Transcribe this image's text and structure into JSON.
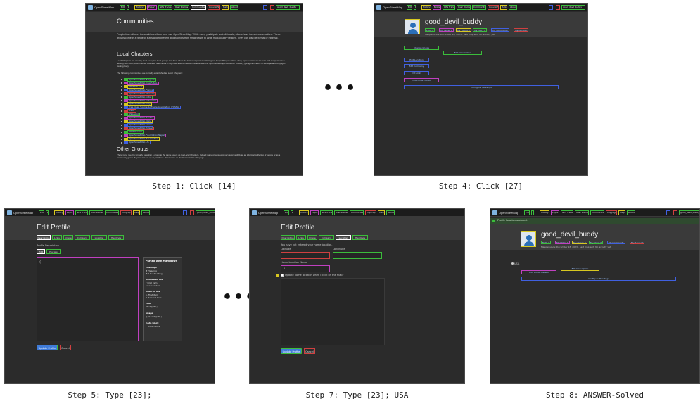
{
  "steps": [
    {
      "caption": "Step 1: Click [14]"
    },
    {
      "caption": "Step 4: Click [27]"
    },
    {
      "caption": "Step 5: Type [23];"
    },
    {
      "caption": "Step 7: Type [23]; USA"
    },
    {
      "caption": "Step 8: ANSWER-Solved"
    }
  ],
  "ellipsis": "•••",
  "osm": {
    "brand": "OpenStreetMap",
    "nav_items": [
      "Edit",
      "▾",
      "History",
      "Export",
      "GPS Traces",
      "User Diaries",
      "Communities",
      "Copyright",
      "Help",
      "About"
    ],
    "user": "good_devil_buddy"
  },
  "communities": {
    "title": "Communities",
    "intro": "People from all over the world contribute to or use OpenStreetMap. While many participate as individuals, others have formed communities. These groups come in a range of sizes and represent geographies from small towns to large multi-country regions. They can also be formal or informal.",
    "local_title": "Local Chapters",
    "local_text": "Local Chapters are country-level or region-level groups that have taken the formal step of establishing not-for-profit legal entities. They represent the area's map and mappers when dealing with local governments, business, and media. They have also formed an affiliation with the OpenStreetMap Foundation (OSMF), giving them a link to the legal and copyright-owning body.",
    "list_intro": "The following communities are formally established as Local Chapters:",
    "chapters": [
      "OpenStreetMap Belgium",
      "OpenStreetMap Czech Rep.",
      "FOSSGIS e.V.",
      "OpenStreetMap France",
      "OpenStreetMap Hungary",
      "OpenStreetMap India",
      "OpenStreetMap Indonesia",
      "OpenStreetMap Italy",
      "Free Open Source Software Association (FOSSA)",
      "OSMF",
      "OSGeo.nl",
      "OpenStreetMap Austria",
      "OpenStreetMap Chile",
      "OpenStreetMap Japan",
      "OpenStreetMap Poland",
      "OSM Ukraine",
      "OpenStreetMap Foundation Nepal",
      "OpenStreetMap Association",
      "OpenStreetMap US"
    ],
    "other_title": "Other Groups",
    "other_text": "There is no need to formally establish a group to the same extent as the Local Chapters. Indeed many groups exist very successfully as an informal gathering of people or as a community group. Anyone can set up or join these. Read more on the Communities wiki page."
  },
  "profile": {
    "username": "good_devil_buddy",
    "stats": [
      "Edits 0",
      "My Notes 0",
      "My Traces 0",
      "My Diary 0",
      "My Comments",
      "My Account"
    ],
    "meta": "Mapper since: December 18, 2023 · Last map edit: No activity yet",
    "links": [
      "Change Image",
      "Edit Description",
      "Edit Location",
      "Edit Company",
      "Edit Links",
      "Edit Profile Details",
      "Configure Headings"
    ]
  },
  "edit_profile": {
    "title": "Edit Profile",
    "tabs": [
      "Description",
      "Links",
      "Image",
      "Company",
      "Location",
      "Headings"
    ],
    "desc_label": "Profile Description",
    "edit_tab": "Edit",
    "preview_tab": "Preview",
    "editor_text": "⟨",
    "parsed_title": "Parsed with Markdown",
    "help": [
      {
        "h": "Headings",
        "t": "# Heading\n## Subheading"
      },
      {
        "h": "Unordered list",
        "t": "* First item\n* Second item"
      },
      {
        "h": "Ordered list",
        "t": "1. First item\n2. Second item"
      },
      {
        "h": "Link",
        "t": "[Text](URL)"
      },
      {
        "h": "Image",
        "t": "![Alt text](URL)"
      },
      {
        "h": "Code block",
        "t": "    Code block"
      }
    ],
    "update_label": "Update Profile",
    "cancel_label": "Cancel"
  },
  "location": {
    "note": "You have not entered your home location.",
    "lat_label": "Latitude",
    "lon_label": "Longitude",
    "name_label": "Home Location Name",
    "name_value": "A",
    "checkbox_label": "Update home location when I click on the map?"
  },
  "final": {
    "flash": "Profile location updated.",
    "location_label": "USA",
    "edit_description": "Edit Description",
    "edit_details": "Edit Profile Details",
    "configure": "Configure Headings"
  }
}
